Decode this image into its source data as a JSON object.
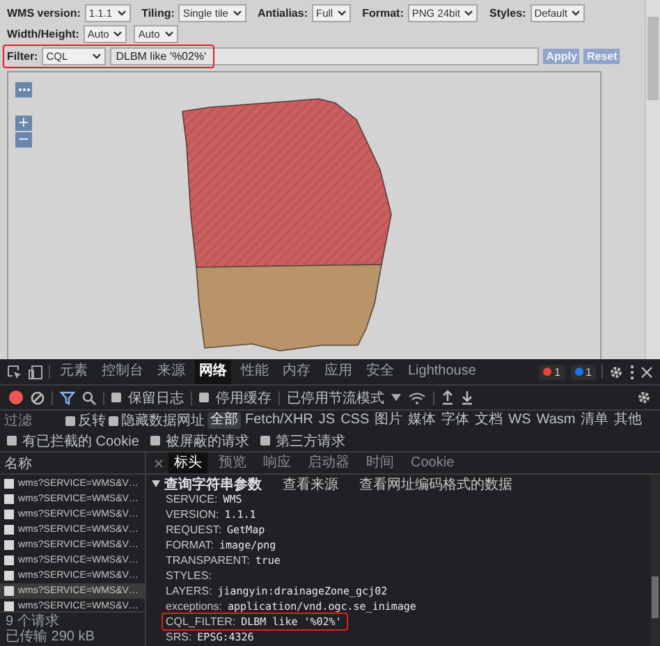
{
  "option_rows": [
    [
      {
        "label": "WMS version:",
        "values": [
          "1.1.1"
        ]
      },
      {
        "label": "Tiling:",
        "values": [
          "Single tile"
        ]
      },
      {
        "label": "Antialias:",
        "values": [
          "Full"
        ]
      },
      {
        "label": "Format:",
        "values": [
          "PNG 24bit"
        ]
      },
      {
        "label": "Styles:",
        "values": [
          "Default"
        ]
      }
    ],
    [
      {
        "label": "Width/Height:",
        "values": [
          "Auto",
          "Auto"
        ]
      }
    ]
  ],
  "filter": {
    "label": "Filter:",
    "type": "CQL",
    "value": "DLBM like '%02%'",
    "highlighted": true,
    "buttons": [
      "Apply",
      "Reset"
    ]
  },
  "map": {
    "zoom_buttons": [
      "+",
      "−"
    ]
  },
  "devtools": {
    "tabs": [
      {
        "label": "元素",
        "selected": false
      },
      {
        "label": "控制台",
        "selected": false
      },
      {
        "label": "来源",
        "selected": false
      },
      {
        "label": "网络",
        "selected": true
      },
      {
        "label": "性能",
        "selected": false
      },
      {
        "label": "内存",
        "selected": false
      },
      {
        "label": "应用",
        "selected": false
      },
      {
        "label": "安全",
        "selected": false
      },
      {
        "label": "Lighthouse",
        "selected": false
      }
    ],
    "badges": [
      {
        "count": "1",
        "color": "#e8453c"
      },
      {
        "count": "1",
        "color": "#1a73e8"
      }
    ],
    "toolbar_checkboxes": [
      {
        "label": "保留日志",
        "checked": false
      },
      {
        "label": "停用缓存",
        "checked": false
      }
    ],
    "throttle": "已停用节流模式",
    "filter": {
      "placeholder": "过滤",
      "checkboxes": [
        {
          "label": "反转",
          "checked": false
        },
        {
          "label": "隐藏数据网址",
          "checked": false
        }
      ],
      "types": [
        {
          "label": "全部",
          "selected": true
        },
        {
          "label": "Fetch/XHR",
          "selected": false
        },
        {
          "label": "JS",
          "selected": false
        },
        {
          "label": "CSS",
          "selected": false
        },
        {
          "label": "图片",
          "selected": false
        },
        {
          "label": "媒体",
          "selected": false
        },
        {
          "label": "字体",
          "selected": false
        },
        {
          "label": "文档",
          "selected": false
        },
        {
          "label": "WS",
          "selected": false
        },
        {
          "label": "Wasm",
          "selected": false
        },
        {
          "label": "清单",
          "selected": false
        },
        {
          "label": "其他",
          "selected": false
        }
      ]
    },
    "cookie_checkboxes": [
      {
        "label": "有已拦截的 Cookie",
        "checked": false
      },
      {
        "label": "被屏蔽的请求",
        "checked": false
      },
      {
        "label": "第三方请求",
        "checked": false
      }
    ],
    "requests_header": "名称",
    "requests": [
      {
        "name": "wms?SERVICE=WMS&V…",
        "selected": false
      },
      {
        "name": "wms?SERVICE=WMS&V…",
        "selected": false
      },
      {
        "name": "wms?SERVICE=WMS&V…",
        "selected": false
      },
      {
        "name": "wms?SERVICE=WMS&V…",
        "selected": false
      },
      {
        "name": "wms?SERVICE=WMS&V…",
        "selected": false
      },
      {
        "name": "wms?SERVICE=WMS&V…",
        "selected": false
      },
      {
        "name": "wms?SERVICE=WMS&V…",
        "selected": false
      },
      {
        "name": "wms?SERVICE=WMS&V…",
        "selected": true
      },
      {
        "name": "wms?SERVICE=WMS&V…",
        "selected": false
      }
    ],
    "summary": [
      "9 个请求",
      "已传输 290 kB"
    ],
    "detail_tabs": [
      {
        "label": "标头",
        "selected": true
      },
      {
        "label": "预览",
        "selected": false
      },
      {
        "label": "响应",
        "selected": false
      },
      {
        "label": "启动器",
        "selected": false
      },
      {
        "label": "时间",
        "selected": false
      },
      {
        "label": "Cookie",
        "selected": false
      }
    ],
    "section": {
      "title": "查询字符串参数",
      "expanded": true,
      "links": [
        "查看来源",
        "查看网址编码格式的数据"
      ]
    },
    "params": [
      {
        "key": "SERVICE:",
        "value": "WMS",
        "highlighted": false
      },
      {
        "key": "VERSION:",
        "value": "1.1.1",
        "highlighted": false
      },
      {
        "key": "REQUEST:",
        "value": "GetMap",
        "highlighted": false
      },
      {
        "key": "FORMAT:",
        "value": "image/png",
        "highlighted": false
      },
      {
        "key": "TRANSPARENT:",
        "value": "true",
        "highlighted": false
      },
      {
        "key": "STYLES:",
        "highlighted": false
      },
      {
        "key": "LAYERS:",
        "value": "jiangyin:drainageZone_gcj02",
        "highlighted": false
      },
      {
        "key": "exceptions:",
        "value": "application/vnd.ogc.se_inimage",
        "highlighted": false
      },
      {
        "key": "CQL_FILTER:",
        "value": "DLBM like '%02%'",
        "highlighted": true
      },
      {
        "key": "SRS:",
        "value": "EPSG:4326",
        "highlighted": false
      }
    ]
  }
}
